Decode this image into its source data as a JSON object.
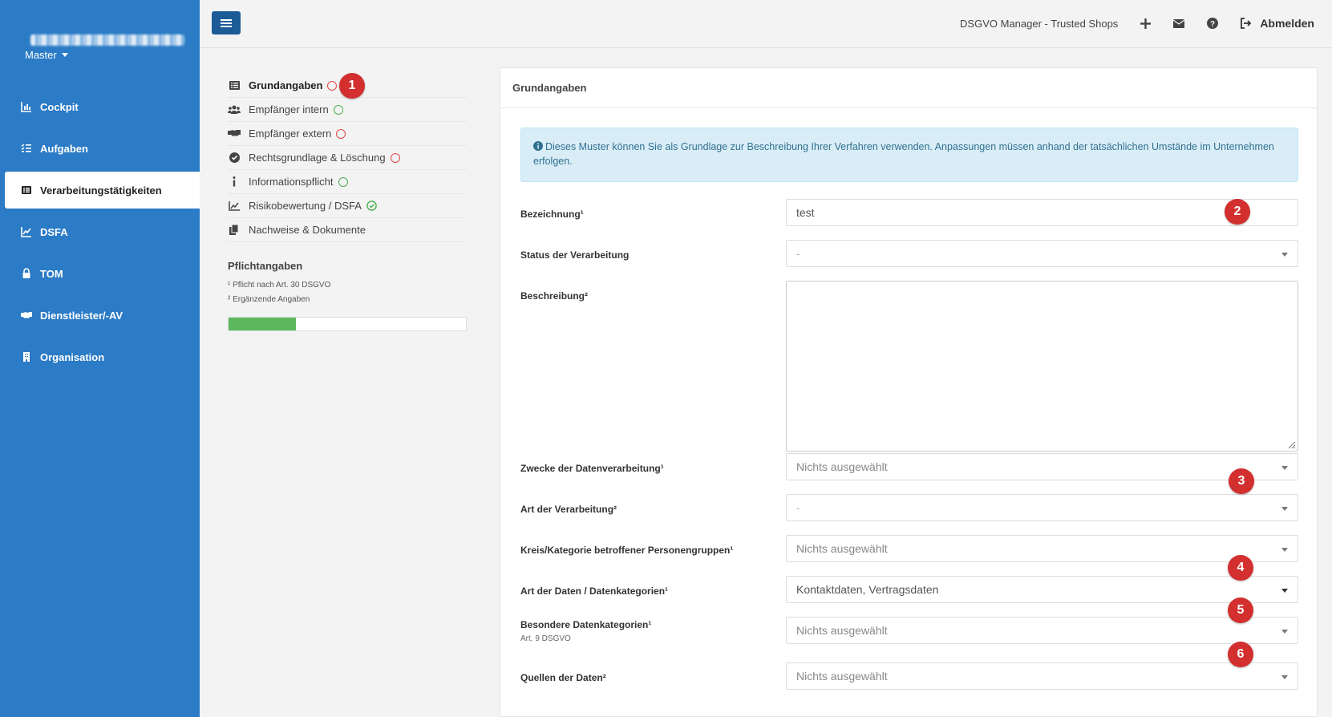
{
  "sidebar": {
    "master_label": "Master",
    "items": [
      {
        "label": "Cockpit",
        "icon": "chart-bar-icon"
      },
      {
        "label": "Aufgaben",
        "icon": "tasks-icon"
      },
      {
        "label": "Verarbeitungstätigkeiten",
        "icon": "list-alt-icon",
        "active": true
      },
      {
        "label": "DSFA",
        "icon": "chart-line-icon"
      },
      {
        "label": "TOM",
        "icon": "lock-icon"
      },
      {
        "label": "Dienstleister/-AV",
        "icon": "handshake-icon"
      },
      {
        "label": "Organisation",
        "icon": "building-icon"
      }
    ]
  },
  "topbar": {
    "title": "DSGVO Manager - Trusted Shops",
    "logout_label": "Abmelden"
  },
  "subnav": {
    "items": [
      {
        "label": "Grundangaben",
        "status": "red",
        "active": true
      },
      {
        "label": "Empfänger intern",
        "status": "green"
      },
      {
        "label": "Empfänger extern",
        "status": "red"
      },
      {
        "label": "Rechtsgrundlage & Löschung",
        "status": "red"
      },
      {
        "label": "Informationspflicht",
        "status": "green"
      },
      {
        "label": "Risikobewertung / DSFA",
        "status": "check"
      },
      {
        "label": "Nachweise & Dokumente",
        "status": "none"
      }
    ],
    "pflicht_title": "Pflichtangaben",
    "note1": "¹ Pflicht nach Art. 30 DSGVO",
    "note2": "² Ergänzende Angaben",
    "progress": 0.285
  },
  "panel": {
    "title": "Grundangaben",
    "alert": "Dieses Muster können Sie als Grundlage zur Beschreibung Ihrer Verfahren verwenden. Anpassungen müssen anhand der tatsächlichen Umstände im Unternehmen erfolgen.",
    "fields": {
      "bezeichnung": {
        "label": "Bezeichnung¹",
        "value": "test"
      },
      "status": {
        "label": "Status der Verarbeitung",
        "value": "-"
      },
      "beschreibung": {
        "label": "Beschreibung²",
        "value": ""
      },
      "zwecke": {
        "label": "Zwecke der Datenverarbeitung¹",
        "value": "Nichts ausgewählt"
      },
      "art_verarbeitung": {
        "label": "Art der Verarbeitung²",
        "value": "-"
      },
      "kreis": {
        "label": "Kreis/Kategorie betroffener Personengruppen¹",
        "value": "Nichts ausgewählt"
      },
      "art_daten": {
        "label": "Art der Daten / Datenkategorien¹",
        "value": "Kontaktdaten, Vertragsdaten"
      },
      "besondere": {
        "label": "Besondere Datenkategorien¹",
        "sub": "Art. 9 DSGVO",
        "value": "Nichts ausgewählt"
      },
      "quellen": {
        "label": "Quellen der Daten²",
        "value": "Nichts ausgewählt"
      }
    }
  },
  "callouts": [
    "1",
    "2",
    "3",
    "4",
    "5",
    "6"
  ],
  "colors": {
    "sidebar": "#2b7bc6",
    "menu_button": "#1d5b97",
    "callout": "#d32f2f",
    "status_red": "#e04848",
    "status_green": "#4caf50",
    "progress": "#5cb85c"
  }
}
